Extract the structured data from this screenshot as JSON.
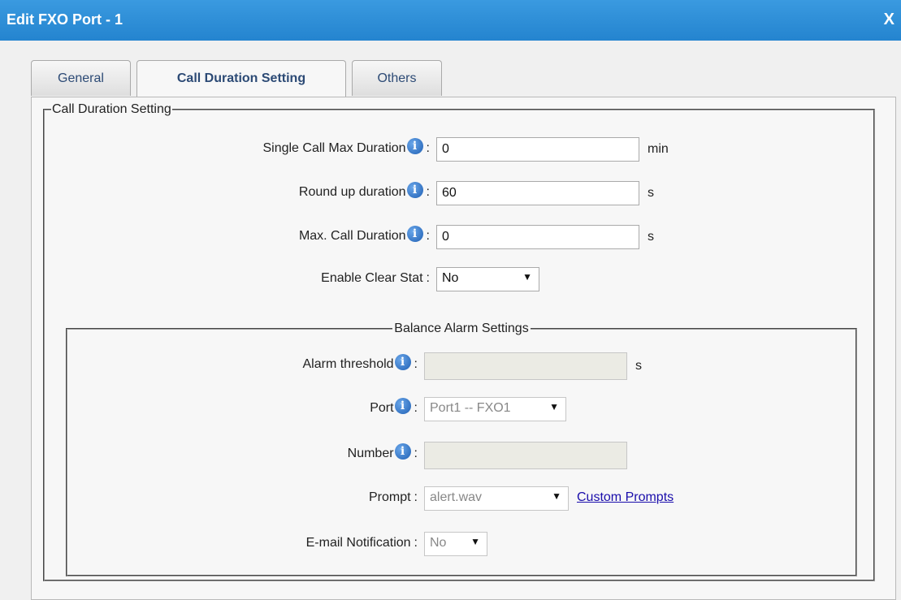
{
  "dialog": {
    "title": "Edit FXO Port - 1",
    "close_label": "X"
  },
  "tabs": [
    {
      "label": "General"
    },
    {
      "label": "Call Duration Setting"
    },
    {
      "label": "Others"
    }
  ],
  "section": {
    "legend": "Call Duration Setting",
    "single_max": {
      "label": "Single Call Max Duration",
      "value": "0",
      "unit": "min"
    },
    "round_up": {
      "label": "Round up duration",
      "value": "60",
      "unit": "s"
    },
    "max_call": {
      "label": "Max. Call Duration",
      "value": "0",
      "unit": "s"
    },
    "clear_stat": {
      "label": "Enable Clear Stat",
      "value": "No"
    }
  },
  "balance": {
    "legend": "Balance Alarm Settings",
    "alarm_threshold": {
      "label": "Alarm threshold",
      "value": "",
      "unit": "s"
    },
    "port": {
      "label": "Port",
      "value": "Port1 -- FXO1"
    },
    "number": {
      "label": "Number",
      "value": ""
    },
    "prompt": {
      "label": "Prompt",
      "value": "alert.wav",
      "link": "Custom Prompts"
    },
    "email": {
      "label": "E-mail Notification",
      "value": "No"
    }
  },
  "colors": {
    "titlebar": "#2a8ad6",
    "link": "#1a0dab",
    "tab_text": "#2c4a75"
  },
  "icons": {
    "info": "info-circle-icon",
    "dropdown": "dropdown-arrow-icon"
  }
}
